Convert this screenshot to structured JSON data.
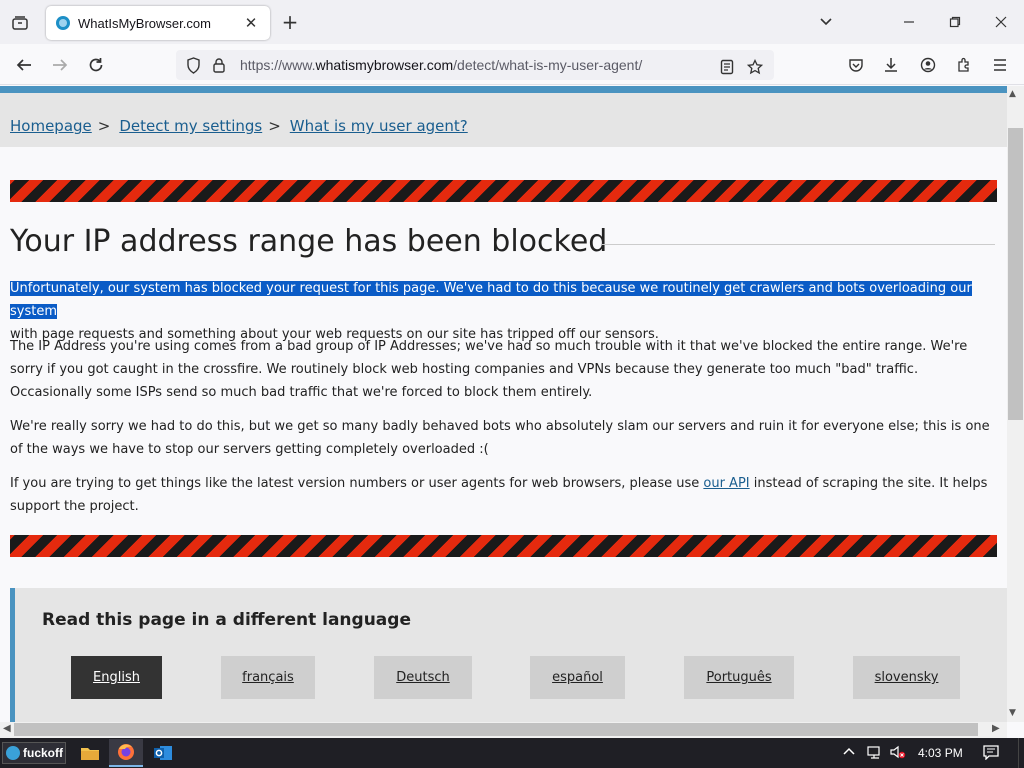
{
  "browser": {
    "tab_title": "WhatIsMyBrowser.com",
    "url_prefix": "https://www.",
    "url_domain": "whatismybrowser.com",
    "url_path": "/detect/what-is-my-user-agent/"
  },
  "breadcrumb": {
    "home": "Homepage",
    "detect": "Detect my settings",
    "current": "What is my user agent?",
    "separator": ">"
  },
  "page": {
    "heading": "Your IP address range has been blocked",
    "p1_selected": "Unfortunately, our system has blocked your request for this page. We've had to do this because we routinely get crawlers and bots overloading our system",
    "p1_rest": "with page requests and something about your web requests on our site has tripped off our sensors.",
    "p2": "The IP Address you're using comes from a bad group of IP Addresses; we've had so much trouble with it that we've blocked the entire range. We're sorry if you got caught in the crossfire. We routinely block web hosting companies and VPNs because they generate too much \"bad\" traffic. Occasionally some ISPs send so much bad traffic that we're forced to block them entirely.",
    "p3": "We're really sorry we had to do this, but we get so many badly behaved bots who absolutely slam our servers and ruin it for everyone else; this is one of the ways we have to stop our servers getting completely overloaded :(",
    "p4_before": "If you are trying to get things like the latest version numbers or user agents for web browsers, please use ",
    "p4_link": "our API",
    "p4_after": " instead of scraping the site. It helps support the project."
  },
  "languages": {
    "heading": "Read this page in a different language",
    "items": [
      "English",
      "français",
      "Deutsch",
      "español",
      "Português",
      "slovensky"
    ],
    "active": "English"
  },
  "taskbar": {
    "start_label": "fuckoff",
    "time": "4:03 PM"
  },
  "colors": {
    "accent_blue": "#4a93c0",
    "hazard_red": "#e52a0e",
    "hazard_black": "#1a1a1a",
    "selection": "#0b5cc6",
    "link": "#1a5e8f"
  },
  "icons": [
    "tab-list-icon",
    "favicon-icon",
    "close-tab-icon",
    "new-tab-icon",
    "list-all-tabs-icon",
    "minimize-icon",
    "maximize-icon",
    "close-window-icon",
    "back-icon",
    "forward-icon",
    "reload-icon",
    "shield-icon",
    "lock-icon",
    "reader-view-icon",
    "bookmark-star-icon",
    "pocket-icon",
    "downloads-icon",
    "account-icon",
    "extensions-icon",
    "menu-icon"
  ]
}
